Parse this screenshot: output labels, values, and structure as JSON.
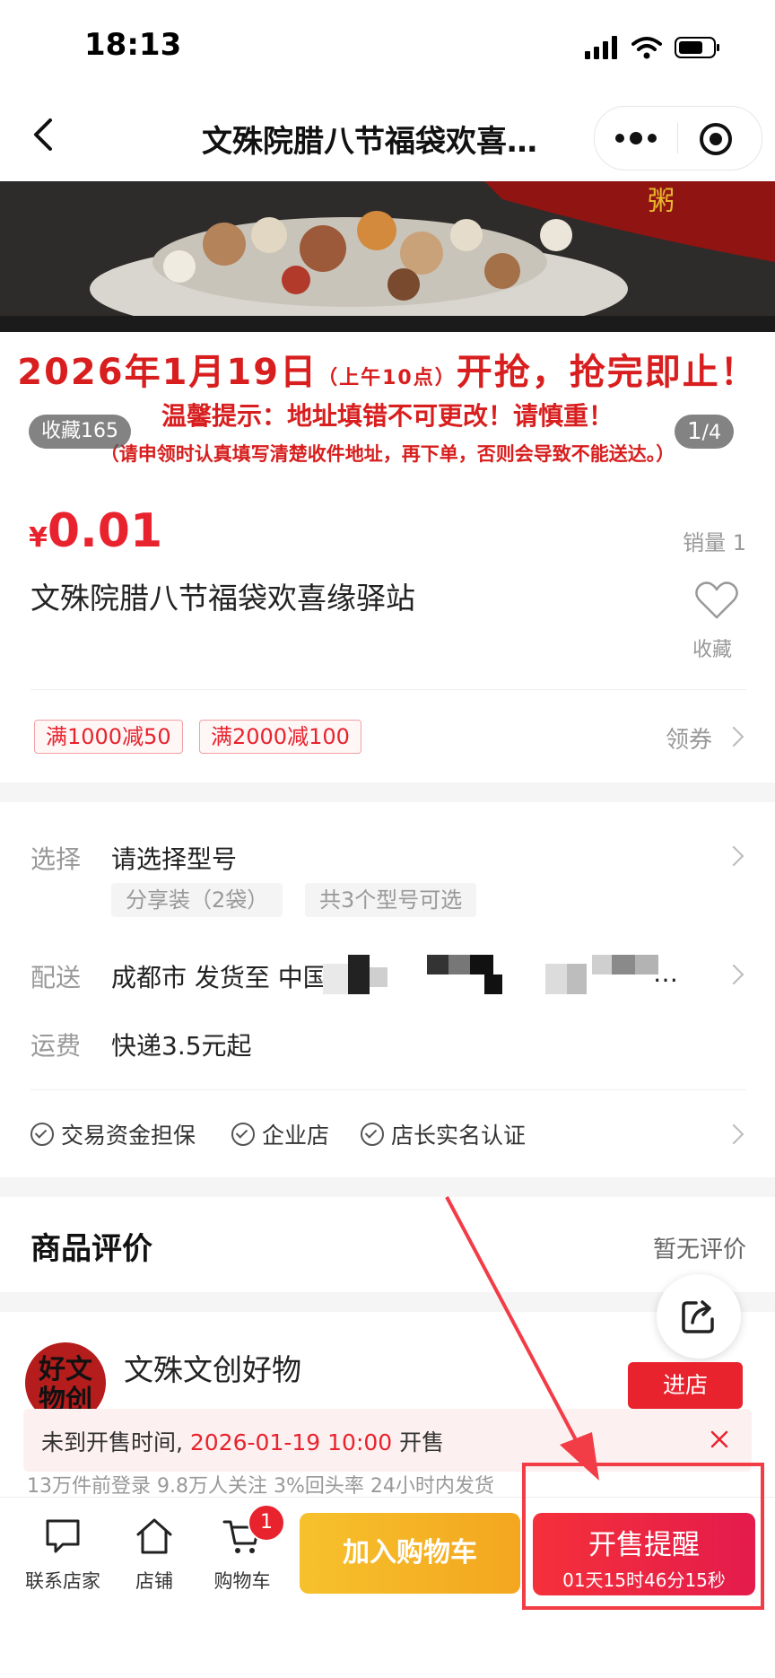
{
  "status_bar": {
    "time": "18:13"
  },
  "nav": {
    "title": "文殊院腊八节福袋欢喜…"
  },
  "banner": {
    "headline_date": "2026年1月19日",
    "headline_time": "（上午10点）",
    "headline_rest": "开抢，抢完即止！",
    "tip": "温馨提示：地址填错不可更改！请慎重！",
    "note": "（请申领时认真填写清楚收件地址，再下单，否则会导致不能送达。）",
    "favorites": "收藏165",
    "page_current": "1",
    "page_total": "/4"
  },
  "product": {
    "currency": "¥",
    "price": "0.01",
    "sales": "销量 1",
    "title": "文殊院腊八节福袋欢喜缘驿站",
    "fav_label": "收藏"
  },
  "coupons": {
    "items": [
      "满1000减50",
      "满2000减100"
    ],
    "get_label": "领券"
  },
  "specs": {
    "select_label": "选择",
    "select_value": "请选择型号",
    "options": [
      "分享装（2袋）",
      "共3个型号可选"
    ],
    "delivery_label": "配送",
    "delivery_value": "成都市 发货至 中国四",
    "delivery_tail": "…",
    "shipping_label": "运费",
    "shipping_value": "快递3.5元起",
    "guarantees": [
      "交易资金担保",
      "企业店",
      "店长实名认证"
    ]
  },
  "reviews": {
    "title": "商品评价",
    "status": "暂无评价"
  },
  "shop": {
    "logo_text": "好文物创",
    "name": "文殊文创好物",
    "enter_label": "进店",
    "stats": "13万件前登录      9.8万人关注      3%回头率      24小时内发货"
  },
  "notice": {
    "prefix": "未到开售时间, ",
    "datetime": "2026-01-19 10:00",
    "suffix": " 开售"
  },
  "bottom_bar": {
    "contact_label": "联系店家",
    "shop_label": "店铺",
    "cart_label": "购物车",
    "cart_count": "1",
    "add_cart_label": "加入购物车",
    "remind_label": "开售提醒",
    "countdown": "01天15时46分15秒"
  },
  "colors": {
    "accent": "#e8232e",
    "cart_button": "#f4b323",
    "annotation": "#f23c46"
  }
}
